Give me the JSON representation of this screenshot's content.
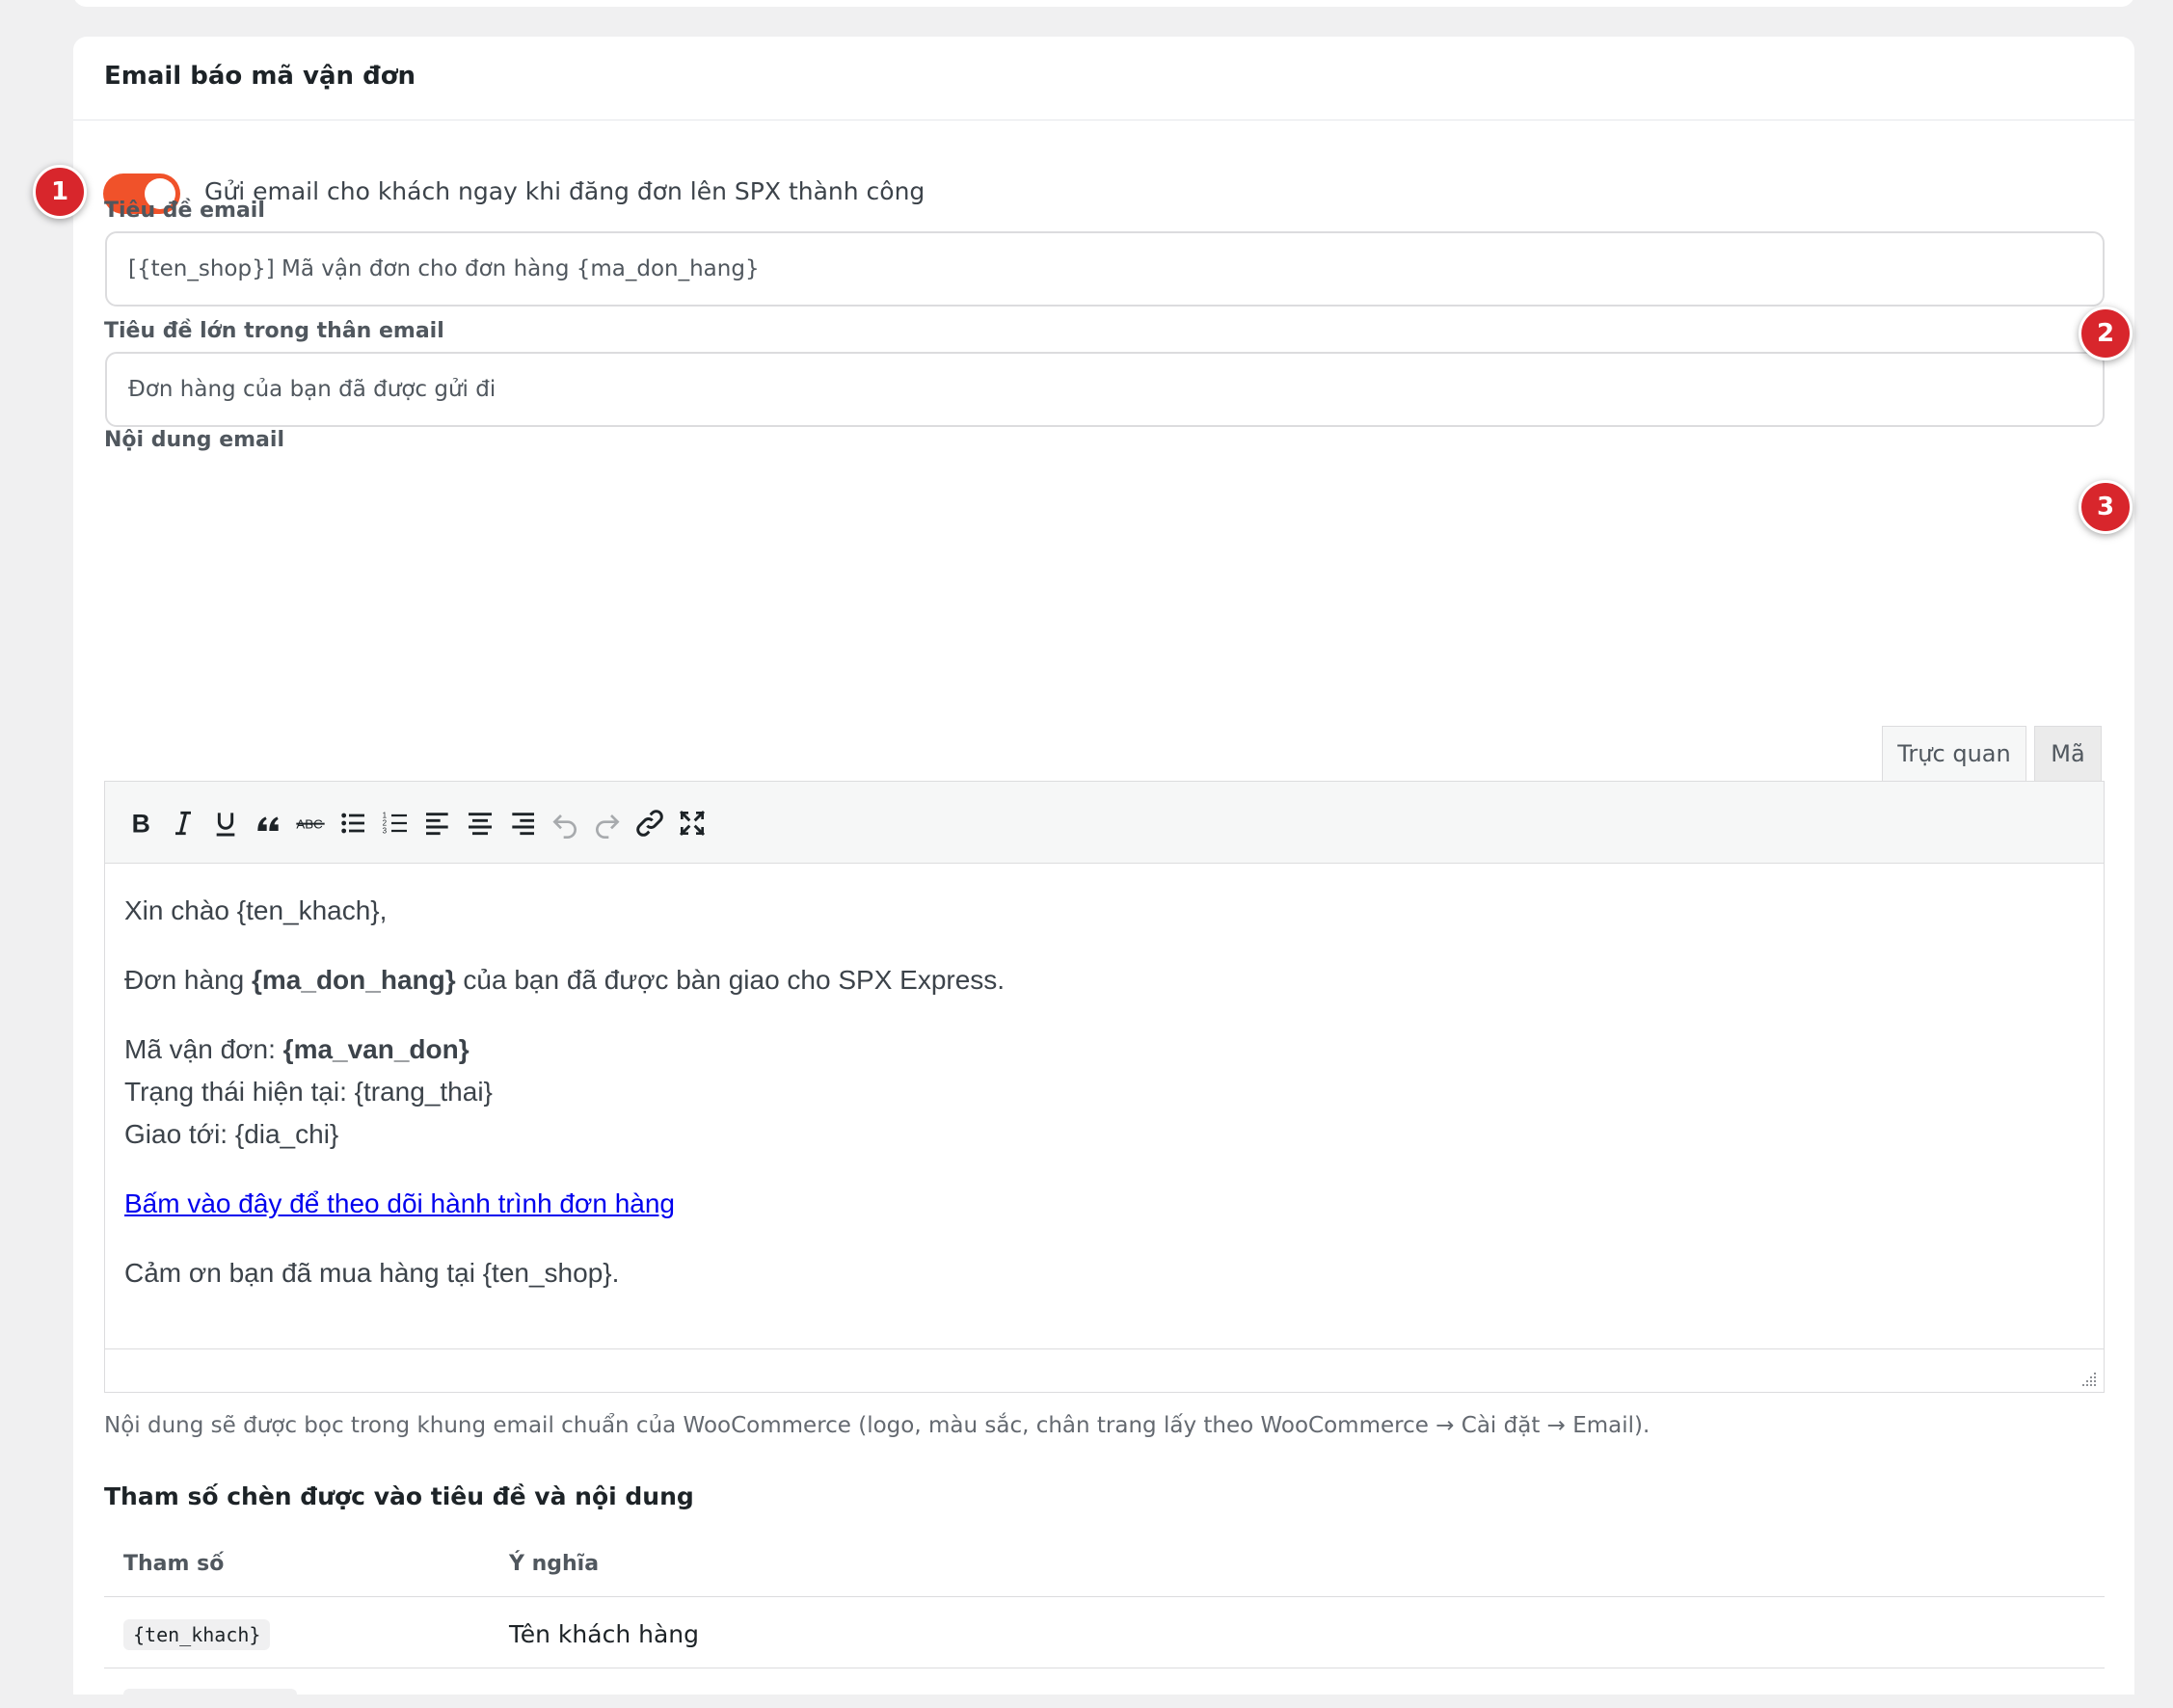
{
  "section": {
    "title": "Email báo mã vận đơn"
  },
  "toggle": {
    "label": "Gửi email cho khách ngay khi đăng đơn lên SPX thành công",
    "checked": true,
    "color": "#f0522a"
  },
  "badges": [
    "1",
    "2",
    "3"
  ],
  "subject": {
    "label": "Tiêu đề email",
    "value": "[{ten_shop}] Mã vận đơn cho đơn hàng {ma_don_hang}"
  },
  "heading": {
    "label": "Tiêu đề lớn trong thân email",
    "value": "Đơn hàng của bạn đã được gửi đi"
  },
  "body": {
    "label": "Nội dung email",
    "tabs": [
      "Trực quan",
      "Mã"
    ],
    "toolbar_icons": [
      "bold-icon",
      "italic-icon",
      "underline-icon",
      "blockquote-icon",
      "strikethrough-icon",
      "bullet-list-icon",
      "numbered-list-icon",
      "align-left-icon",
      "align-center-icon",
      "align-right-icon",
      "undo-icon",
      "redo-icon",
      "link-icon",
      "fullscreen-icon"
    ],
    "greeting": "Xin chào {ten_khach},",
    "order_line_prefix": "Đơn hàng ",
    "order_line_var": "{ma_don_hang}",
    "order_line_suffix": " của bạn đã được bàn giao cho SPX Express.",
    "tracking_prefix": "Mã vận đơn: ",
    "tracking_var": "{ma_van_don}",
    "status_line": "Trạng thái hiện tại: {trang_thai}",
    "address_line": "Giao tới: {dia_chi}",
    "link_text": "Bấm vào đây để theo dõi hành trình đơn hàng",
    "thanks": "Cảm ơn bạn đã mua hàng tại {ten_shop}."
  },
  "help": "Nội dung sẽ được bọc trong khung email chuẩn của WooCommerce (logo, màu sắc, chân trang lấy theo WooCommerce → Cài đặt → Email).",
  "params": {
    "title": "Tham số chèn được vào tiêu đề và nội dung",
    "headers": [
      "Tham số",
      "Ý nghĩa"
    ],
    "rows": [
      {
        "code": "{ten_khach}",
        "meaning": "Tên khách hàng"
      }
    ]
  }
}
